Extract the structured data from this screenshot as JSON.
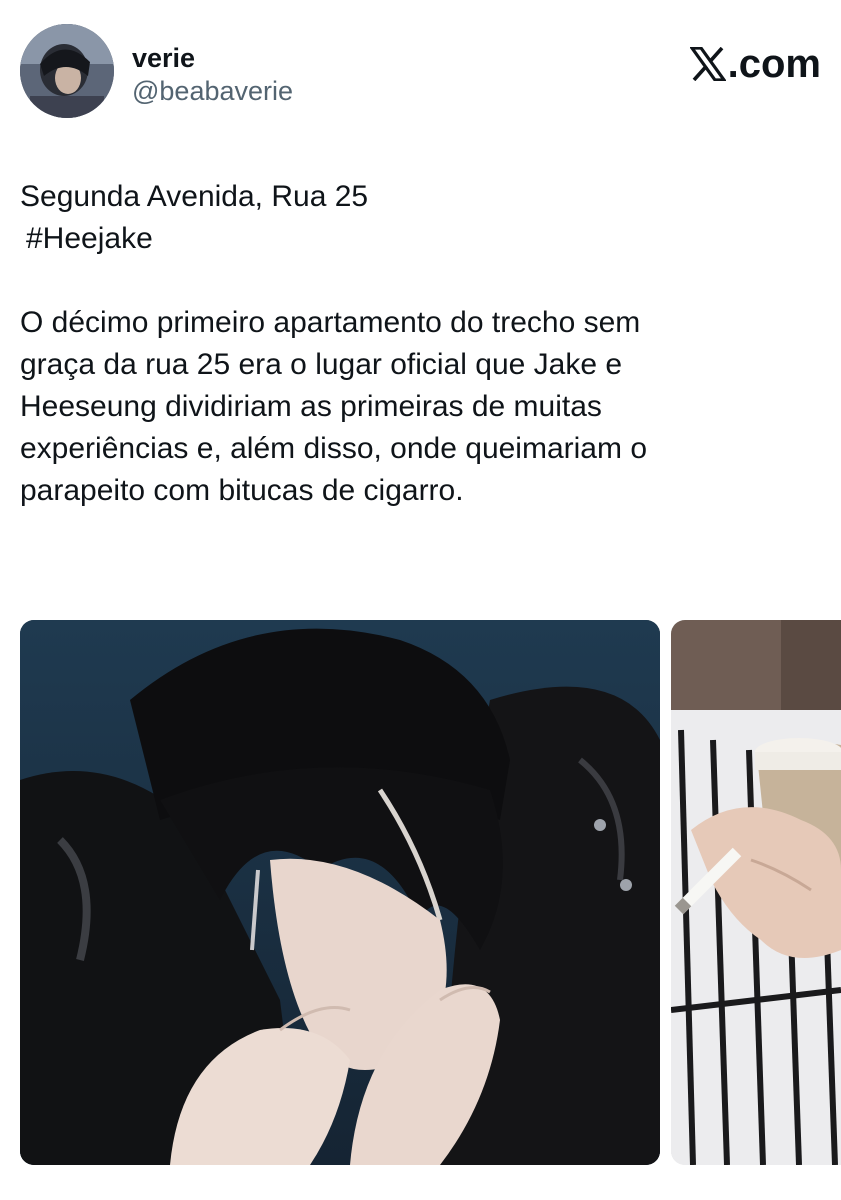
{
  "author": {
    "display_name": "verie",
    "handle": "@beabaverie"
  },
  "brand": {
    "label": ".com",
    "icon": "x-logo-icon"
  },
  "tweet": {
    "line1": "Segunda Avenida, Rua 25",
    "hashtag": "#Heejake",
    "body": [
      "O décimo primeiro apartamento do trecho sem",
      "graça da rua 25 era o lugar oficial que Jake e",
      "Heeseung dividiriam as primeiras de muitas",
      "experiências e, além disso, onde queimariam o",
      "parapeito com bitucas de cigarro."
    ]
  },
  "colors": {
    "text": "#0f1419",
    "secondary": "#536471",
    "background": "#ffffff"
  }
}
